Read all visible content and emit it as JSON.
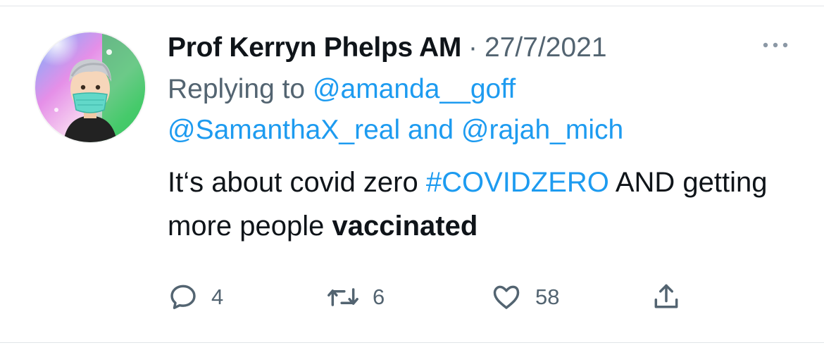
{
  "tweet": {
    "author_name": "Prof Kerryn Phelps AM",
    "separator": "·",
    "date": "27/7/2021",
    "replying_to_label": "Replying to ",
    "mentions": [
      "@amanda__goff",
      "@SamanthaX_real",
      "@rajah_mich"
    ],
    "mentions_joiner": " and ",
    "text_part1": "It‘s about covid zero ",
    "hashtag": "#COVIDZERO",
    "text_part2": " AND getting more people ",
    "text_bold": "vaccinated"
  },
  "actions": {
    "reply_count": "4",
    "retweet_count": "6",
    "like_count": "58"
  },
  "icons": {
    "more": "more-horizontal-icon",
    "reply": "speech-bubble-icon",
    "retweet": "retweet-arrows-icon",
    "like": "heart-icon",
    "share": "share-upload-icon"
  },
  "colors": {
    "link": "#1d9bf0",
    "secondary_text": "#536471",
    "primary_text": "#0f1419"
  }
}
